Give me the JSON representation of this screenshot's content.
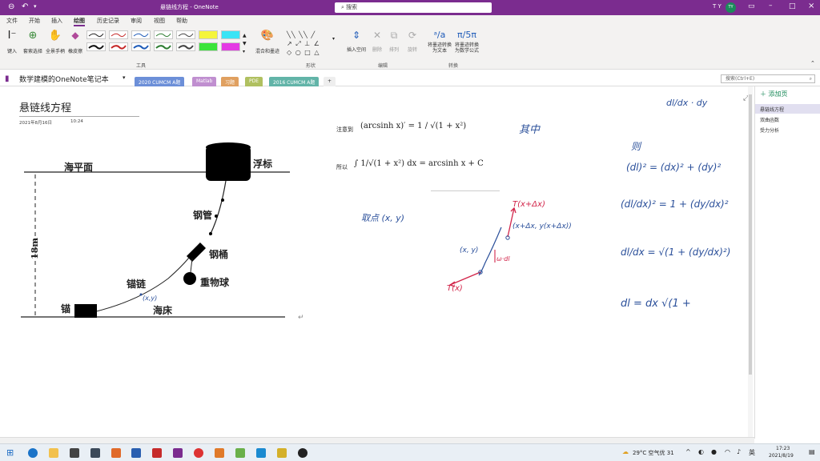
{
  "app": {
    "window_title": "悬链线方程 - OneNote",
    "search_placeholder": "搜索",
    "user_initials": "T Y",
    "avatar_initials": "TY"
  },
  "menu": [
    "文件",
    "开始",
    "插入",
    "绘图",
    "历史记录",
    "审阅",
    "视图",
    "帮助"
  ],
  "ribbon": {
    "tools": [
      {
        "label": "键入"
      },
      {
        "label": "套索选择"
      },
      {
        "label": "全景手柄"
      },
      {
        "label": "橡皮擦"
      }
    ],
    "group_tools": "工具",
    "mix_label": "混合和墨迹",
    "group_shapes": "形状",
    "insert_space": "插入空间",
    "erase": "删除",
    "arrange": "排列",
    "rotate": "旋转",
    "group_edit": "编辑",
    "ink_to_text": "将墨迹转换为文本",
    "ink_to_math": "将墨迹转换为数学公式",
    "group_convert": "转换"
  },
  "notebook": {
    "name": "数学建模的OneNote笔记本",
    "sections": [
      {
        "label": "2020 CUMCM A题",
        "color": "#6c8fd8"
      },
      {
        "label": "Matlab",
        "color": "#c08fd0"
      },
      {
        "label": "习题",
        "color": "#e0a060"
      },
      {
        "label": "PDE",
        "color": "#b0c060"
      },
      {
        "label": "2016 CUMCM A题",
        "color": "#62b4a8"
      }
    ],
    "add_section": "+",
    "search_hint": "搜索(Ctrl+E)"
  },
  "pages": {
    "add_page": "添加页",
    "items": [
      "悬链线方程",
      "双曲函数",
      "受力分析"
    ]
  },
  "page": {
    "title": "悬链线方程",
    "date": "2021年8月16日",
    "time": "10:24"
  },
  "diagram": {
    "sea_level": "海平面",
    "buoy": "浮标",
    "steel_pipe": "钢管",
    "steel_drum": "钢桶",
    "heavy_ball": "重物球",
    "anchor_chain": "锚链",
    "anchor": "锚",
    "seabed": "海床",
    "depth": "18m",
    "point_label": "(x,y)"
  },
  "math": {
    "note_prefix": "注意到",
    "eq1": "(arcsinh x)′ = 1 / √(1 + x²)",
    "so_prefix": "所以",
    "eq2": "∫ 1/√(1 + x²) dx = arcsinh x + C"
  },
  "handwriting": {
    "qizhong": "其中",
    "take_point": "取点 (x, y)",
    "T_upper": "T(x+Δx)",
    "point_upper": "(x+Δx, y(x+Δx))",
    "point_lower": "(x, y)",
    "wdl": "ω·dl",
    "T_lower": "T(x)",
    "dl_dx_dy": "dl/dx · dy",
    "then": "则",
    "eq_a": "(dl)² = (dx)² + (dy)²",
    "eq_b": "(dl/dx)² = 1 + (dy/dx)²",
    "eq_c": "dl/dx = √(1 + (dy/dx)²)",
    "eq_d": "dl = dx √(1 +"
  },
  "status": {
    "weather": "29°C 空气优 31",
    "time": "17:23",
    "date": "2021/8/19"
  },
  "colors": {
    "accent": "#7b2c8f",
    "ink_blue": "#2a4f9a",
    "ink_red": "#d2254a"
  }
}
